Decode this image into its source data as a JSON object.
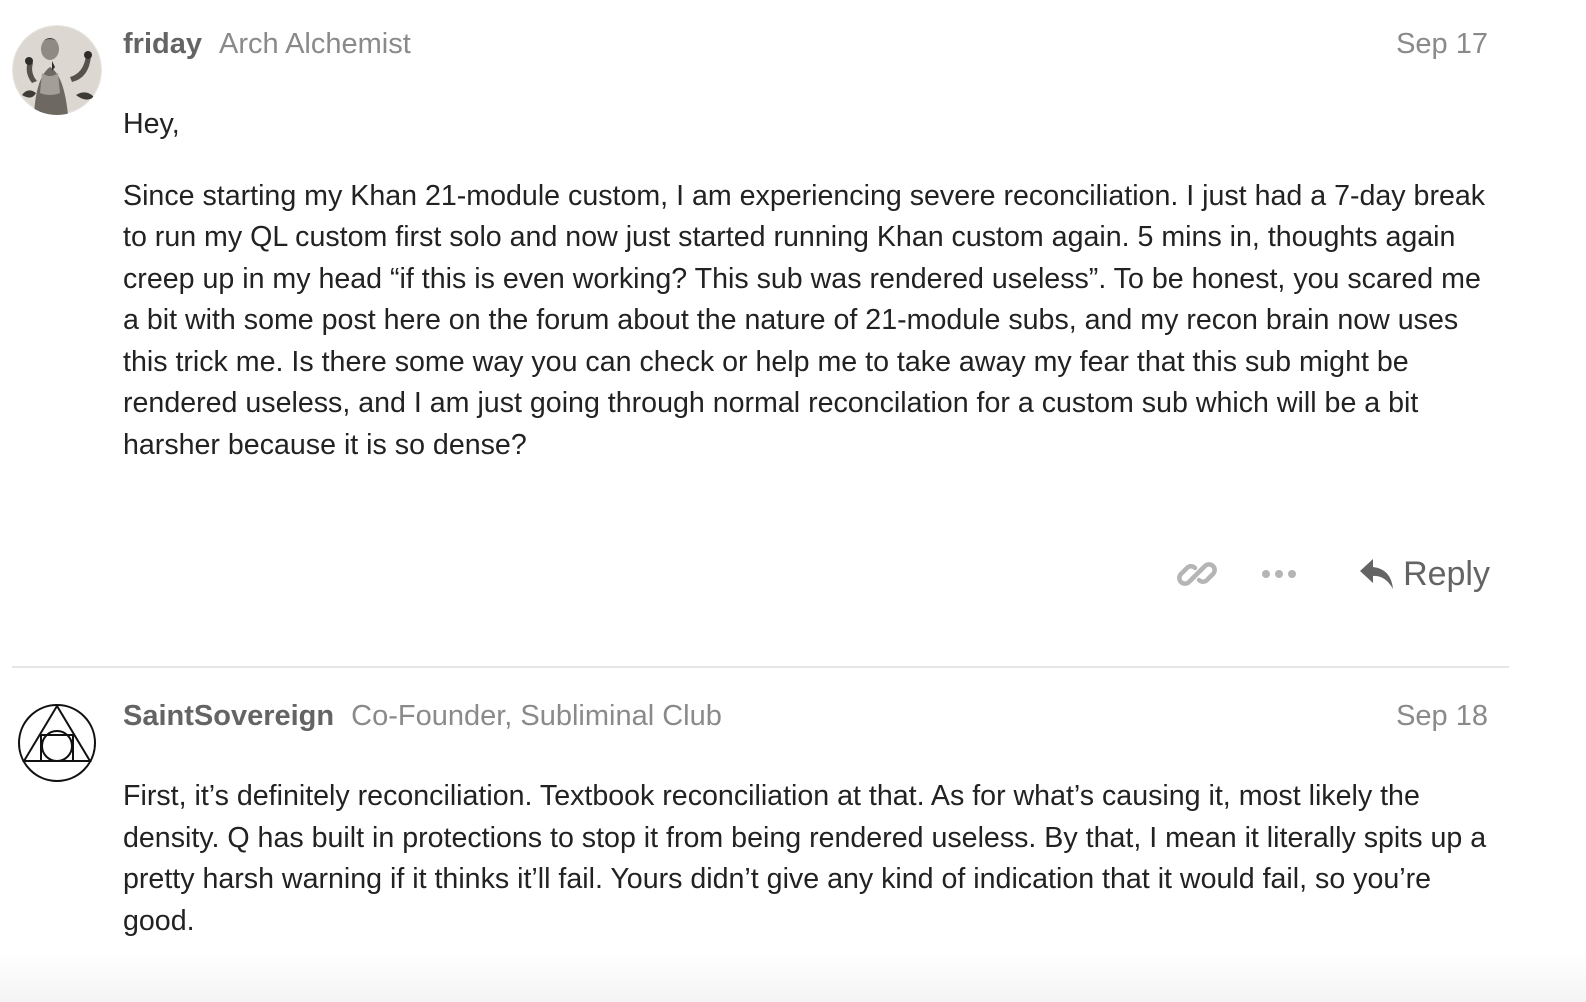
{
  "posts": [
    {
      "username": "friday",
      "user_title": "Arch Alchemist",
      "date": "Sep 17",
      "avatar": "portrait-sketch-avatar",
      "paragraphs": [
        "Hey,",
        "Since starting my Khan 21-module custom, I am experiencing severe reconciliation. I just had a 7-day break to run my QL custom first solo and now just started running Khan custom again. 5 mins in, thoughts again creep up in my head “if this is even working? This sub was rendered useless”. To be honest, you scared me a bit with some post here on the forum about the nature of 21-module subs, and my recon brain now uses this trick me. Is there some way you can check or help me to take away my fear that this sub might be rendered useless, and I am just going through normal reconcilation for a custom sub which will be a bit harsher because it is so dense?"
      ],
      "actions": {
        "link_icon": "link-icon",
        "more_icon": "ellipsis-icon",
        "reply_icon": "reply-arrow-icon",
        "reply_label": "Reply"
      }
    },
    {
      "username": "SaintSovereign",
      "user_title": "Co-Founder, Subliminal Club",
      "date": "Sep 18",
      "avatar": "alchemy-triangle-circle-avatar",
      "paragraphs": [
        "First, it’s definitely reconciliation. Textbook reconciliation at that. As for what’s causing it, most likely the density. Q has built in protections to stop it from being rendered useless. By that, I mean it literally spits up a pretty harsh warning if it thinks it’ll fail. Yours didn’t give any kind of indication that it would fail, so you’re good."
      ]
    }
  ],
  "colors": {
    "username": "#646464",
    "meta_gray": "#8a8a8a",
    "body_text": "#222222",
    "icon_gray": "#b5b5b5",
    "divider": "#e6e6e6"
  }
}
